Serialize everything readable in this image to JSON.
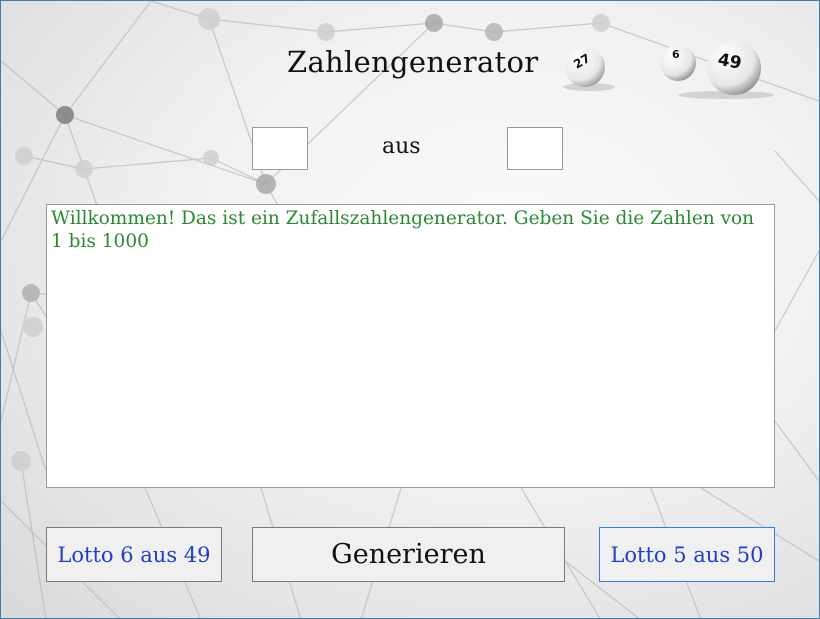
{
  "header": {
    "title": "Zahlengenerator"
  },
  "balls": [
    {
      "number": "27"
    },
    {
      "number": "6"
    },
    {
      "number": "49"
    }
  ],
  "inputs": {
    "count_value": "",
    "max_value": "",
    "separator_label": "aus"
  },
  "output": {
    "text": "Willkommen! Das ist ein Zufallszahlengenerator. Geben Sie die Zahlen von 1 bis 1000"
  },
  "buttons": {
    "lotto_6_49": "Lotto 6 aus 49",
    "generate": "Generieren",
    "lotto_5_50": "Lotto 5 aus 50"
  },
  "colors": {
    "output_text": "#2a8a34",
    "lotto_button_text": "#1f3fc8",
    "window_border": "#3a7fae"
  }
}
